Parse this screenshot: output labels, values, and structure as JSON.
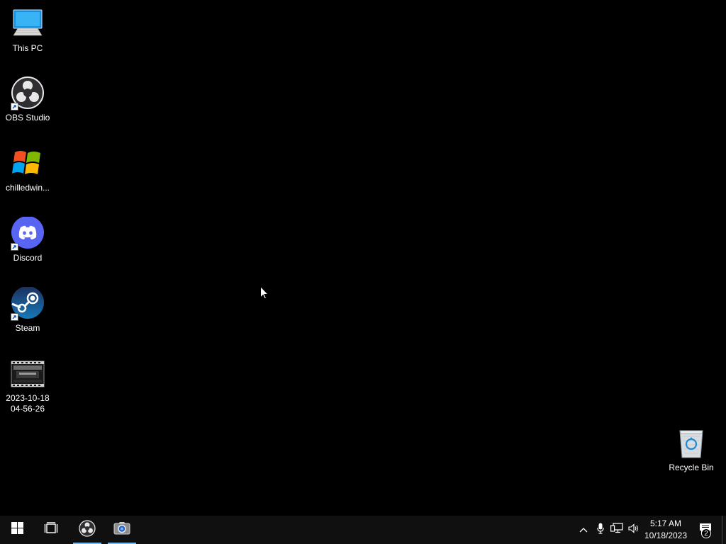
{
  "desktop": {
    "icons": [
      {
        "label": "This PC",
        "icon": "this-pc-icon",
        "shortcut": false
      },
      {
        "label": "OBS Studio",
        "icon": "obs-studio-icon",
        "shortcut": true
      },
      {
        "label": "chilledwin...",
        "icon": "windows-flag-icon",
        "shortcut": false
      },
      {
        "label": "Discord",
        "icon": "discord-icon",
        "shortcut": true
      },
      {
        "label": "Steam",
        "icon": "steam-icon",
        "shortcut": true
      },
      {
        "label": "2023-10-18\n04-56-26",
        "icon": "video-file-icon",
        "shortcut": false
      }
    ],
    "recycle_bin": {
      "label": "Recycle Bin",
      "icon": "recycle-bin-icon"
    }
  },
  "taskbar": {
    "start_icon": "windows-start-icon",
    "task_view_icon": "task-view-icon",
    "pinned": [
      {
        "name": "obs-studio",
        "icon": "obs-studio-icon",
        "active": true
      },
      {
        "name": "camera",
        "icon": "camera-icon",
        "active": true
      }
    ],
    "tray": {
      "icons": [
        "chevron-up-icon",
        "microphone-icon",
        "network-icon",
        "volume-icon"
      ],
      "time": "5:17 AM",
      "date": "10/18/2023",
      "notification_count": "2"
    }
  },
  "colors": {
    "desktop_background": "#000000",
    "taskbar_background": "#101010",
    "accent": "#76b9ed",
    "discord": "#5865f2"
  }
}
